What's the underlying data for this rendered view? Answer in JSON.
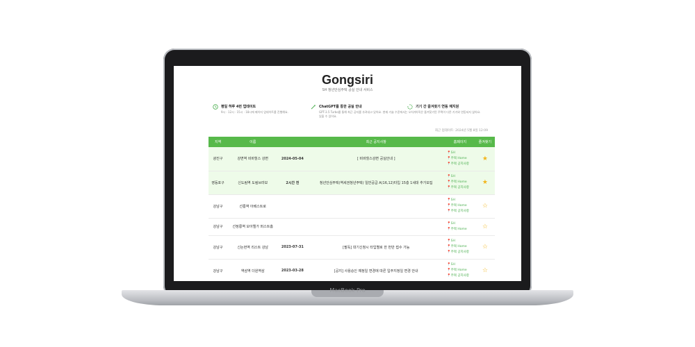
{
  "device": {
    "label": "MacBook Pro"
  },
  "header": {
    "title": "Gongsiri",
    "subtitle": "SH 청년안심주택 공실 안내 서비스"
  },
  "features": [
    {
      "icon": "clock-icon",
      "title": "평일 하루 4번 업데이트",
      "desc": "9시 · 12시 · 15시 · 18시에 페이지 업데이트를 진행해요."
    },
    {
      "icon": "magic-wand-icon",
      "title": "ChatGPT를 통한 공실 안내",
      "desc": "GPT-3.5 Turbo를 통해 최근 공지를 추려내고 있어요. 현재 기술 수준에서는 오차가 있을 수 있어요."
    },
    {
      "icon": "loading-icon",
      "title": "기기 간 즐겨찾기 연동 예지원",
      "desc": "아직은 즐겨찾기된 주택이 다른 기기와 연동되지 않아요."
    }
  ],
  "updated_text": "최근 업데이트: 2024년 5월 8일 12:09",
  "table": {
    "headers": [
      "지역",
      "이름",
      "최근 공지사항",
      "홈페이지",
      "즐겨찾기"
    ],
    "rows": [
      {
        "region": "광진구",
        "name": "강변역 비바힐스 강변",
        "date": "2024-05-04",
        "notice": "[ 비바힐스강변 공실안내 ]",
        "links": [
          "SH",
          "주택 Home",
          "주택 공지사항"
        ],
        "favorite": "★",
        "highlight": true
      },
      {
        "region": "영등포구",
        "name": "신도림역 도림브라보",
        "date": "2시간 전",
        "notice": "청년안심주택(역세권청년주택) 일반공급 A(16,12)타입 15층 1세대 추가모집",
        "links": [
          "SH",
          "주택 Home",
          "주택 공지사항"
        ],
        "favorite": "★",
        "highlight": true
      },
      {
        "region": "강남구",
        "name": "선릉역 아베스트로",
        "date": "",
        "notice": "",
        "links": [
          "SH",
          "주택 Home",
          "주택 공지사항"
        ],
        "favorite": "☆",
        "highlight": false
      },
      {
        "region": "강남구",
        "name": "선정릉역 모아엘가 퍼스트홈",
        "date": "",
        "notice": "",
        "links": [
          "SH",
          "주택 Home"
        ],
        "favorite": "☆",
        "highlight": false
      },
      {
        "region": "강남구",
        "name": "신논현역 리스트 강남",
        "date": "2023-07-31",
        "notice": "[필독] 대기신청시 타입별로 한 번만 접수 가능",
        "links": [
          "SH",
          "주택 Home",
          "주택 공지사항"
        ],
        "favorite": "☆",
        "highlight": false
      },
      {
        "region": "강남구",
        "name": "역삼역 더원역삼",
        "date": "2023-03-28",
        "notice": "[공지] 사용승인 예정일 변경에 따른 입주지정일 변경 안내",
        "links": [
          "SH",
          "주택 Home",
          "주택 공지사항"
        ],
        "favorite": "☆",
        "highlight": false
      }
    ]
  }
}
